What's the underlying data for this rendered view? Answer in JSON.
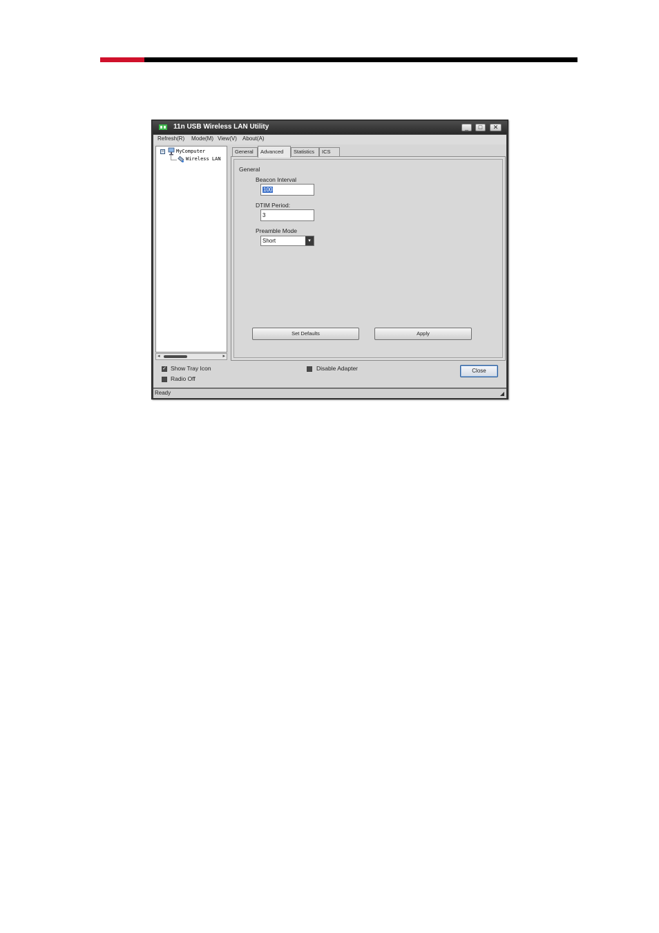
{
  "colors": {
    "accent_red": "#d0112b",
    "title_bar": "#3a3a3a",
    "selection": "#3a6fc8"
  },
  "window": {
    "title": "11n USB Wireless LAN Utility",
    "controls": {
      "minimize": "_",
      "maximize": "□",
      "close": "✕"
    }
  },
  "menu": {
    "items": [
      {
        "label": "Refresh(R)"
      },
      {
        "label": "Mode(M)"
      },
      {
        "label": "View(V)"
      },
      {
        "label": "About(A)"
      }
    ]
  },
  "tree": {
    "expander": "−",
    "root": "MyComputer",
    "child": "Wireless LAN",
    "scroll_left": "◂",
    "scroll_right": "▸"
  },
  "tabs": [
    {
      "label": "General"
    },
    {
      "label": "Advanced",
      "active": true
    },
    {
      "label": "Statistics"
    },
    {
      "label": "ICS"
    }
  ],
  "advanced": {
    "group_label": "General",
    "beacon_label": "Beacon Interval",
    "beacon_value": "100",
    "dtim_label": "DTIM Period:",
    "dtim_value": "3",
    "preamble_label": "Preamble Mode",
    "preamble_value": "Short",
    "preamble_arrow": "▾",
    "set_defaults": "Set Defaults",
    "apply": "Apply"
  },
  "bottom": {
    "show_tray_label": "Show Tray Icon",
    "show_tray_checked": true,
    "radio_off_label": "Radio Off",
    "radio_off_checked": false,
    "disable_adapter_label": "Disable Adapter",
    "disable_adapter_checked": false,
    "check_mark": "✓",
    "close": "Close"
  },
  "status": {
    "text": "Ready",
    "grip": "◢"
  }
}
